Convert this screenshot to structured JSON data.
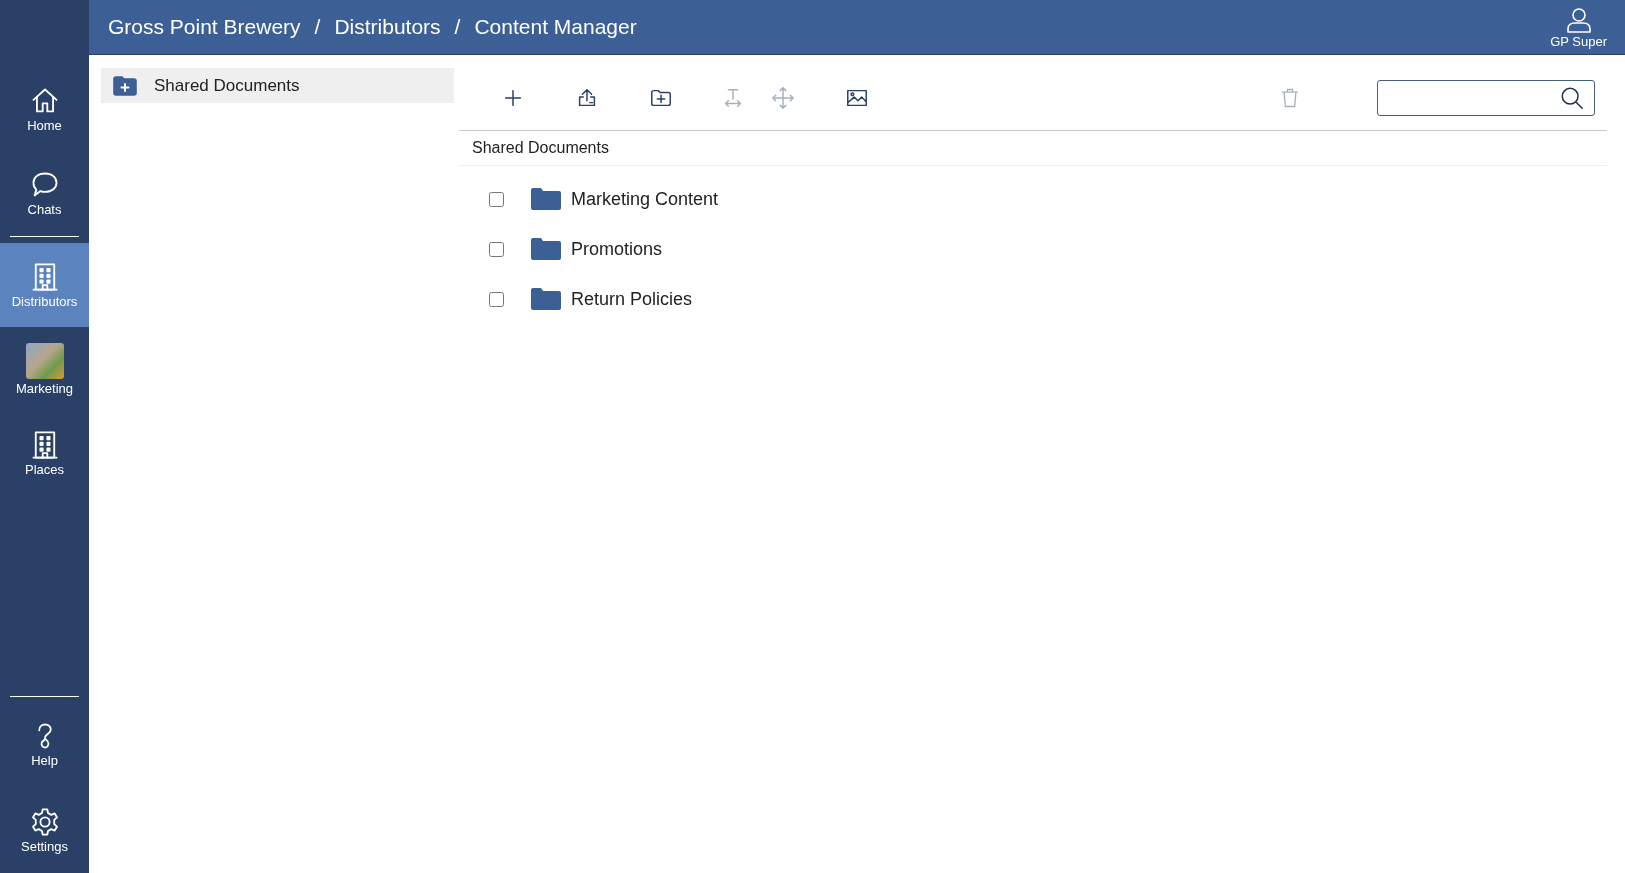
{
  "breadcrumb": [
    {
      "label": "Gross Point Brewery"
    },
    {
      "separator": "/",
      "label": "Distributors"
    },
    {
      "separator": "/",
      "label": "Content Manager"
    }
  ],
  "user": {
    "name": "GP Super"
  },
  "nav": {
    "top": [
      {
        "label": "Home",
        "kind": "icon",
        "selected": false
      },
      {
        "label": "Chats",
        "kind": "icon",
        "selected": false
      }
    ],
    "middle": [
      {
        "label": "Distributors",
        "kind": "icon",
        "selected": true
      },
      {
        "label": "Marketing",
        "kind": "photo",
        "selected": false
      },
      {
        "label": "Places",
        "kind": "icon",
        "selected": false
      }
    ],
    "bottom": [
      {
        "label": "Help",
        "kind": "icon",
        "selected": false
      },
      {
        "label": "Settings",
        "kind": "icon",
        "selected": false
      }
    ]
  },
  "tree": {
    "items": [
      {
        "label": "Shared Documents",
        "selected": true
      }
    ]
  },
  "toolbar": [
    {
      "disabled": false
    },
    {
      "disabled": false
    },
    {
      "disabled": false
    },
    {
      "disabled": true
    },
    {
      "disabled": true
    },
    {
      "disabled": false
    }
  ],
  "delete_button": {
    "disabled": true
  },
  "path": "Shared Documents",
  "files": [
    {
      "name": "Marketing Content",
      "checked": false
    },
    {
      "name": "Promotions",
      "checked": false
    },
    {
      "name": "Return Policies",
      "checked": false
    }
  ]
}
